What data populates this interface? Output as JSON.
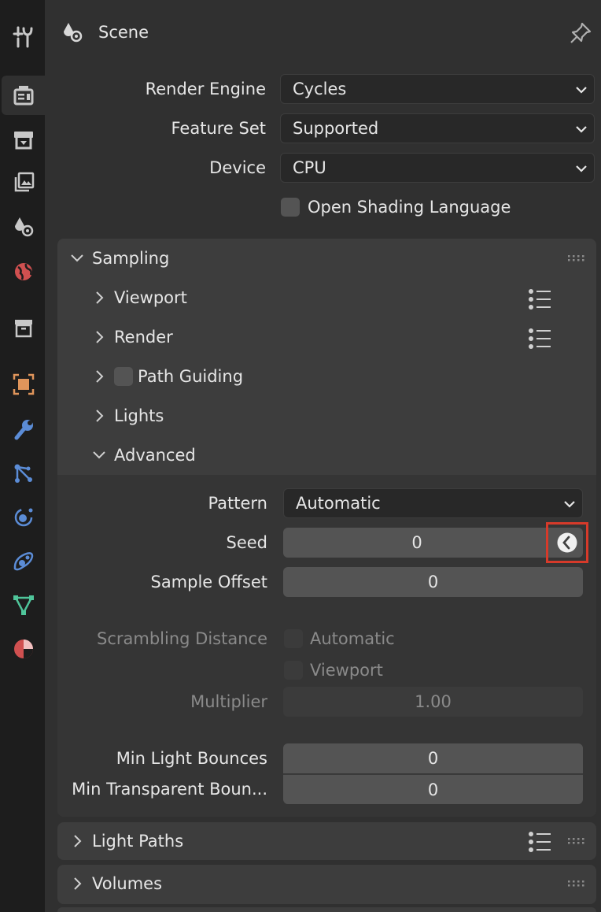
{
  "header": {
    "title": "Scene",
    "pin_icon": "pin-icon",
    "scene_icon": "scene-icon"
  },
  "tabs": [
    {
      "name": "tool-icon",
      "color": "#c8c8c8"
    },
    {
      "name": "render-icon",
      "color": "#c8c8c8",
      "active": true
    },
    {
      "name": "output-icon",
      "color": "#c8c8c8"
    },
    {
      "name": "view-layer-icon",
      "color": "#c8c8c8"
    },
    {
      "name": "scene-icon",
      "color": "#c8c8c8"
    },
    {
      "name": "world-icon",
      "color": "#d05050"
    },
    {
      "name": "collection-icon",
      "color": "#c8c8c8"
    },
    {
      "name": "object-icon",
      "color": "#e0955b"
    },
    {
      "name": "modifier-icon",
      "color": "#5b8cd6"
    },
    {
      "name": "particles-icon",
      "color": "#5b8cd6"
    },
    {
      "name": "physics-icon",
      "color": "#5b8cd6"
    },
    {
      "name": "constraints-icon",
      "color": "#5b8cd6"
    },
    {
      "name": "data-icon",
      "color": "#4fc59a"
    },
    {
      "name": "material-icon",
      "color": "#d05050"
    }
  ],
  "render": {
    "engine_label": "Render Engine",
    "engine_value": "Cycles",
    "feature_label": "Feature Set",
    "feature_value": "Supported",
    "device_label": "Device",
    "device_value": "CPU",
    "osl_label": "Open Shading Language"
  },
  "sampling": {
    "title": "Sampling",
    "viewport": "Viewport",
    "render": "Render",
    "path_guiding": "Path Guiding",
    "lights": "Lights",
    "advanced": "Advanced"
  },
  "advanced": {
    "pattern_label": "Pattern",
    "pattern_value": "Automatic",
    "seed_label": "Seed",
    "seed_value": "0",
    "sample_offset_label": "Sample Offset",
    "sample_offset_value": "0",
    "scrambling_label": "Scrambling Distance",
    "automatic_label": "Automatic",
    "viewport_label": "Viewport",
    "multiplier_label": "Multiplier",
    "multiplier_value": "1.00",
    "min_light_label": "Min Light Bounces",
    "min_light_value": "0",
    "min_transparent_label": "Min Transparent Boun...",
    "min_transparent_value": "0"
  },
  "panels": {
    "light_paths": "Light Paths",
    "volumes": "Volumes"
  },
  "colors": {
    "highlight": "#d63a2a",
    "accent": "#4772b3"
  }
}
